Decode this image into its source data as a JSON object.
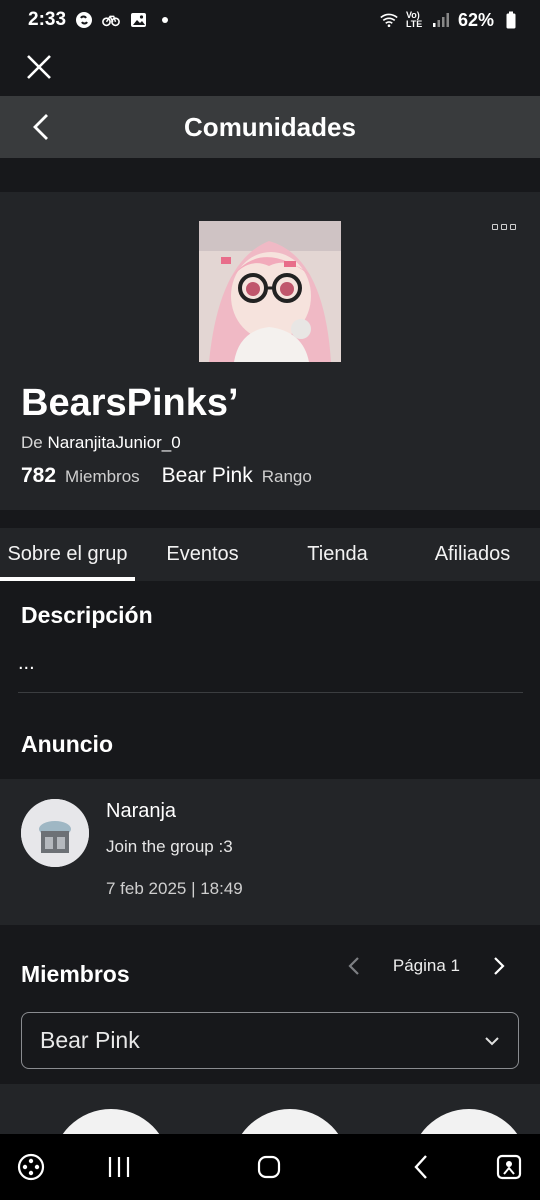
{
  "status_bar": {
    "time": "2:33",
    "battery": "62%",
    "left_icons": [
      "shazam-icon",
      "bicycle-icon",
      "image-icon",
      "dot-icon"
    ],
    "right_icons": [
      "wifi-icon",
      "volte-icon",
      "signal-icon",
      "battery-icon"
    ],
    "volte_label": "Vo) LTE"
  },
  "header": {
    "title": "Comunidades"
  },
  "group": {
    "name": "BearsPinks’",
    "owner_prefix": "De",
    "owner": "NaranjitaJunior_0",
    "member_count": "782",
    "members_label": "Miembros",
    "rank": "Bear Pink",
    "rank_label": "Rango"
  },
  "tabs": [
    {
      "label": "Sobre el grup",
      "active": true
    },
    {
      "label": "Eventos",
      "active": false
    },
    {
      "label": "Tienda",
      "active": false
    },
    {
      "label": "Afiliados",
      "active": false
    }
  ],
  "description": {
    "title": "Descripción",
    "text": "..."
  },
  "announcement": {
    "title": "Anuncio",
    "author": "Naranja",
    "message": "Join the group :3",
    "date": "7 feb 2025 | 18:49"
  },
  "members": {
    "title": "Miembros",
    "page_label": "Página 1",
    "rank_filter": "Bear Pink"
  },
  "colors": {
    "background": "#17181b",
    "card": "#232528",
    "topbar": "#393b3d",
    "accent": "#ffffff"
  }
}
